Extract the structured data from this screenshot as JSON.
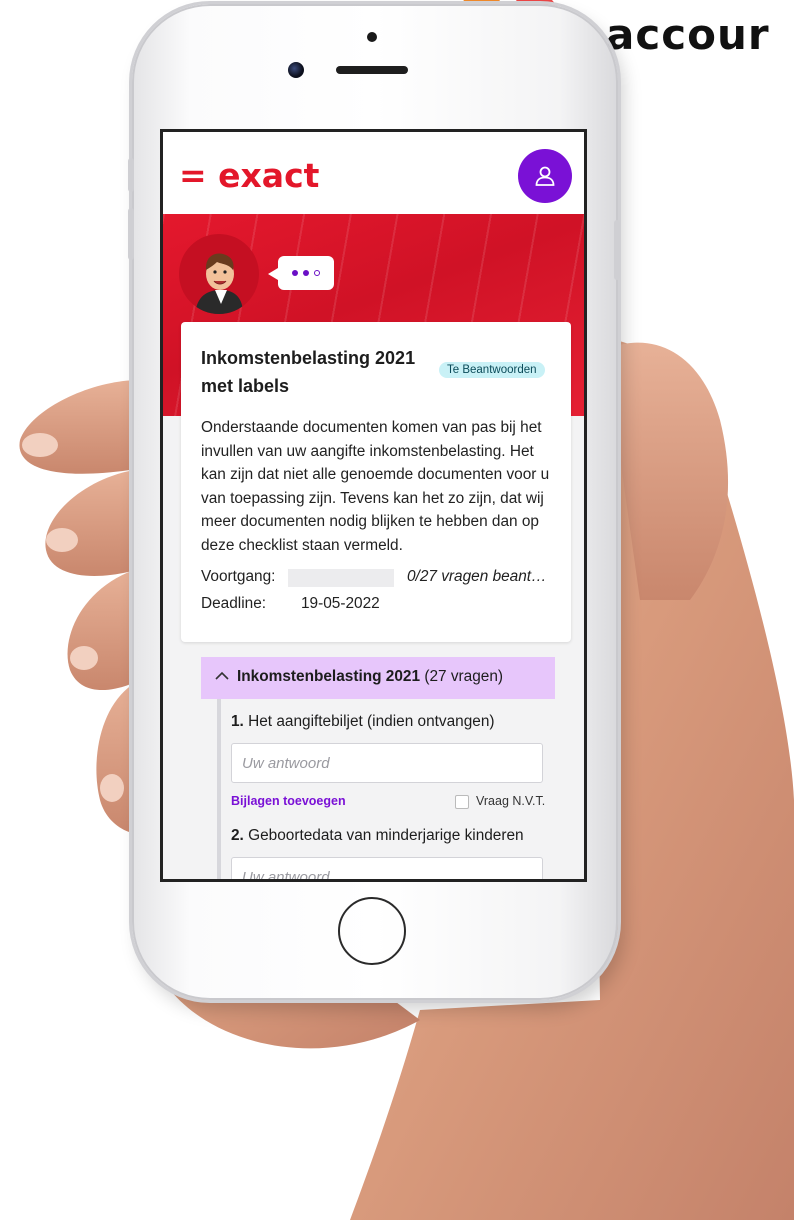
{
  "brand": {
    "word": "accour",
    "top_word": ""
  },
  "app": {
    "logo": "= exact",
    "avatar_icon": "user-icon"
  },
  "checklist": {
    "title": "Inkomstenbelasting 2021 met labels",
    "status": "Te Beantwoorden",
    "description": "Onderstaande documenten komen van pas bij het invullen van uw aangifte inkomstenbelasting. Het kan zijn dat niet alle genoemde documenten voor u van toepassing zijn. Tevens kan het zo zijn, dat wij meer documenten nodig blijken te hebben dan op deze checklist staan vermeld.",
    "progress_label": "Voortgang:",
    "progress_text": "0/27  vragen beant…",
    "progress_fraction": 0,
    "deadline_label": "Deadline:",
    "deadline_value": "19-05-2022"
  },
  "section": {
    "title": "Inkomstenbelasting 2021",
    "count": "(27 vragen)"
  },
  "questions": [
    {
      "number": "1.",
      "text": "Het aangiftebiljet (indien ontvangen)",
      "placeholder": "Uw antwoord",
      "attach_label": "Bijlagen toevoegen",
      "nvt_label": "Vraag N.V.T."
    },
    {
      "number": "2.",
      "text": "Geboortedata van minderjarige kinderen",
      "placeholder": "Uw antwoord"
    }
  ],
  "colors": {
    "brand_red": "#e3172a",
    "accent_purple": "#7a11d6",
    "section_bg": "#e7c6fb",
    "badge_bg": "#c9f1f6"
  }
}
